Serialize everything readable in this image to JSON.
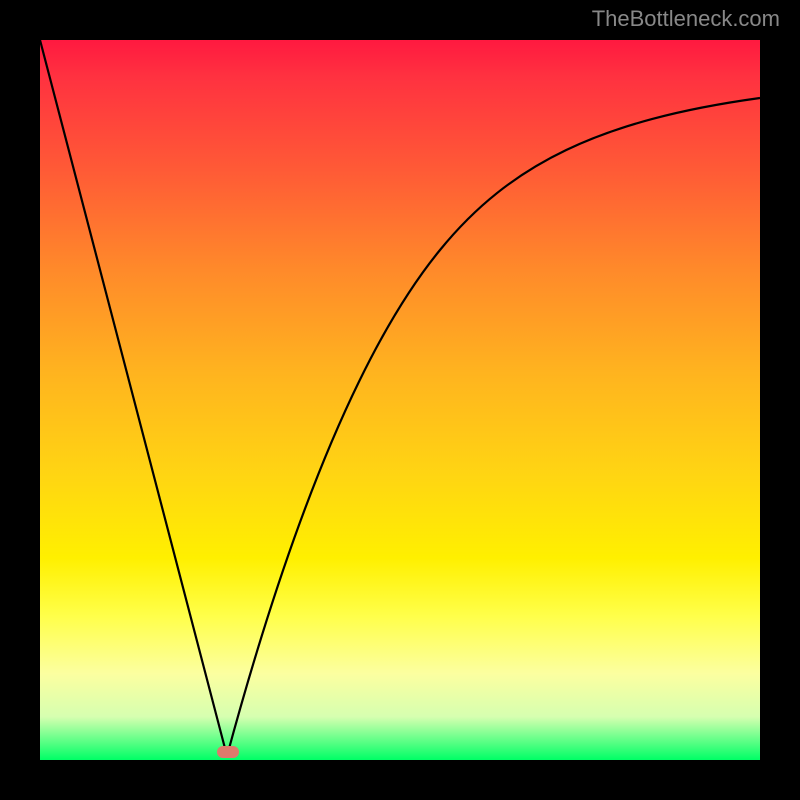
{
  "watermark": "TheBottleneck.com",
  "chart_data": {
    "type": "line",
    "title": "",
    "xlabel": "",
    "ylabel": "",
    "xlim": [
      0,
      100
    ],
    "ylim": [
      0,
      100
    ],
    "series": [
      {
        "name": "left-limb",
        "x": [
          0,
          26
        ],
        "y": [
          100,
          0
        ]
      },
      {
        "name": "right-limb",
        "x": [
          26,
          30,
          35,
          40,
          45,
          50,
          55,
          60,
          65,
          70,
          75,
          80,
          85,
          90,
          95,
          100
        ],
        "y": [
          0,
          17,
          35,
          49,
          59,
          66,
          72,
          76.5,
          80,
          83,
          85.5,
          87.5,
          89,
          90.2,
          91.2,
          92
        ]
      }
    ],
    "marker": {
      "name": "highlight",
      "x": 26,
      "y": 0,
      "color": "#de7a6c"
    },
    "gradient_stops": [
      {
        "pos": 0,
        "color": "#ff1940"
      },
      {
        "pos": 18,
        "color": "#ff5a36"
      },
      {
        "pos": 46,
        "color": "#ffb31f"
      },
      {
        "pos": 72,
        "color": "#fff000"
      },
      {
        "pos": 94,
        "color": "#d6ffb0"
      },
      {
        "pos": 100,
        "color": "#00ff66"
      }
    ]
  }
}
